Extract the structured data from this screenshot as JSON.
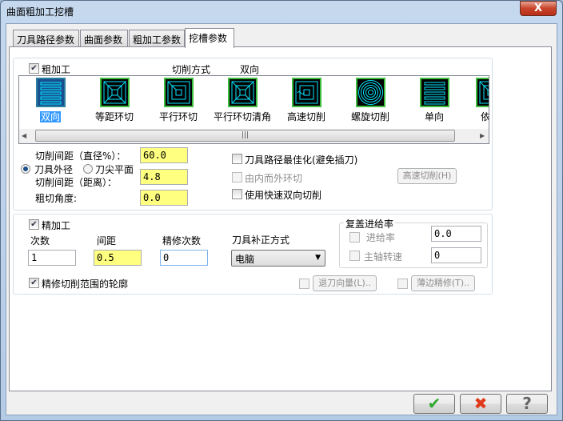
{
  "window": {
    "title": "曲面粗加工挖槽",
    "close_label": "X"
  },
  "tabs": [
    {
      "label": "刀具路径参数"
    },
    {
      "label": "曲面参数"
    },
    {
      "label": "粗加工参数"
    },
    {
      "label": "挖槽参数",
      "active": true
    }
  ],
  "rough": {
    "checkbox_label": "粗加工",
    "checked": true,
    "cut_method_label": "切削方式",
    "cut_method_value": "双向",
    "methods": [
      {
        "label": "双向",
        "icon": "zigzag-icon",
        "selected": true
      },
      {
        "label": "等距环切",
        "icon": "constant-overlap-spiral-icon"
      },
      {
        "label": "平行环切",
        "icon": "parallel-spiral-icon"
      },
      {
        "label": "平行环切清角",
        "icon": "parallel-spiral-clean-corners-icon"
      },
      {
        "label": "高速切削",
        "icon": "high-speed-icon"
      },
      {
        "label": "螺旋切削",
        "icon": "true-spiral-icon"
      },
      {
        "label": "单向",
        "icon": "one-way-icon"
      },
      {
        "label": "依外",
        "icon": "morph-spiral-icon"
      }
    ],
    "stepover_pct_label": "切削间距（直径%）：",
    "stepover_pct": "60.0",
    "radio_tool_dia": "刀具外径",
    "radio_tool_flat": "刀尖平面",
    "radio_selected": "刀具外径",
    "stepover_dist_label": "切削间距（距离）：",
    "stepover_dist": "4.8",
    "angle_label": "粗切角度:",
    "angle": "0.0",
    "opt_minimize": "刀具路径最佳化(避免插刀)",
    "opt_inside_out": "由内而外环切",
    "opt_fast_zigzag": "使用快速双向切削",
    "high_speed_button": "高速切削(H)"
  },
  "finish": {
    "checkbox_label": "精加工",
    "checked": true,
    "passes_label": "次数",
    "passes": "1",
    "spacing_label": "间距",
    "spacing": "0.5",
    "spring_label": "精修次数",
    "spring": "0",
    "comp_label": "刀具补正方式",
    "comp_value": "电脑",
    "override_title": "复盖进给率",
    "feed_label": "进给率",
    "feed": "0.0",
    "spindle_label": "主轴转速",
    "spindle": "0",
    "finish_outer_label": "精修切削范围的轮廓",
    "finish_outer_checked": true,
    "lead_button": "退刀向量(L)..",
    "thin_wall_button": "薄边精修(T).."
  },
  "buttons": {
    "ok": "✔",
    "cancel": "✖",
    "help": "?"
  },
  "colors": {
    "ok": "#2fa82f",
    "cancel": "#e03a1a",
    "selection": "#3399ff",
    "required_field": "#ffff80"
  }
}
